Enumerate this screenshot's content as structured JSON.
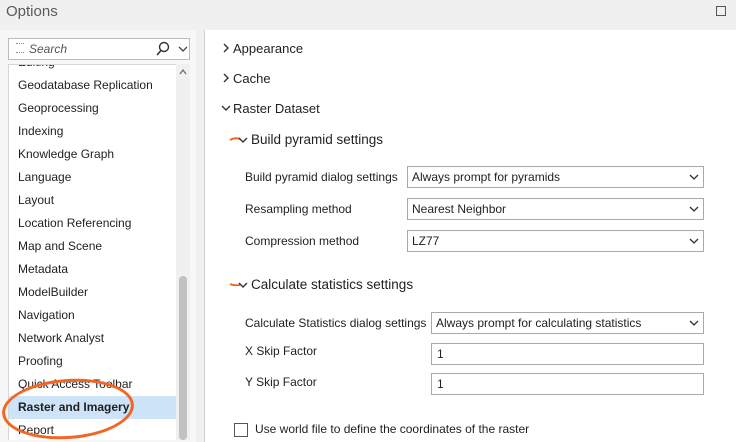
{
  "window": {
    "title": "Options"
  },
  "search": {
    "placeholder": "Search"
  },
  "sidebar": {
    "items": [
      {
        "label": "Editing"
      },
      {
        "label": "Geodatabase Replication"
      },
      {
        "label": "Geoprocessing"
      },
      {
        "label": "Indexing"
      },
      {
        "label": "Knowledge Graph"
      },
      {
        "label": "Language"
      },
      {
        "label": "Layout"
      },
      {
        "label": "Location Referencing"
      },
      {
        "label": "Map and Scene"
      },
      {
        "label": "Metadata"
      },
      {
        "label": "ModelBuilder"
      },
      {
        "label": "Navigation"
      },
      {
        "label": "Network Analyst"
      },
      {
        "label": "Proofing"
      },
      {
        "label": "Quick Access Toolbar"
      },
      {
        "label": "Raster and Imagery"
      },
      {
        "label": "Report"
      }
    ],
    "selected": "Raster and Imagery"
  },
  "main": {
    "sections": [
      {
        "label": "Appearance",
        "expanded": false
      },
      {
        "label": "Cache",
        "expanded": false
      },
      {
        "label": "Raster Dataset",
        "expanded": true
      }
    ],
    "pyramid": {
      "heading": "Build pyramid settings",
      "dialog_label": "Build pyramid dialog settings",
      "dialog_value": "Always prompt for pyramids",
      "resampling_label": "Resampling method",
      "resampling_value": "Nearest Neighbor",
      "compression_label": "Compression method",
      "compression_value": "LZ77"
    },
    "statistics": {
      "heading": "Calculate statistics settings",
      "dialog_label": "Calculate Statistics dialog settings",
      "dialog_value": "Always prompt for calculating statistics",
      "xskip_label": "X Skip Factor",
      "xskip_value": "1",
      "yskip_label": "Y Skip Factor",
      "yskip_value": "1"
    },
    "world_file": {
      "label": "Use world file to define the coordinates of the raster",
      "checked": false
    }
  },
  "colors": {
    "annotation": "#f26522",
    "selection": "#cde3f7"
  }
}
